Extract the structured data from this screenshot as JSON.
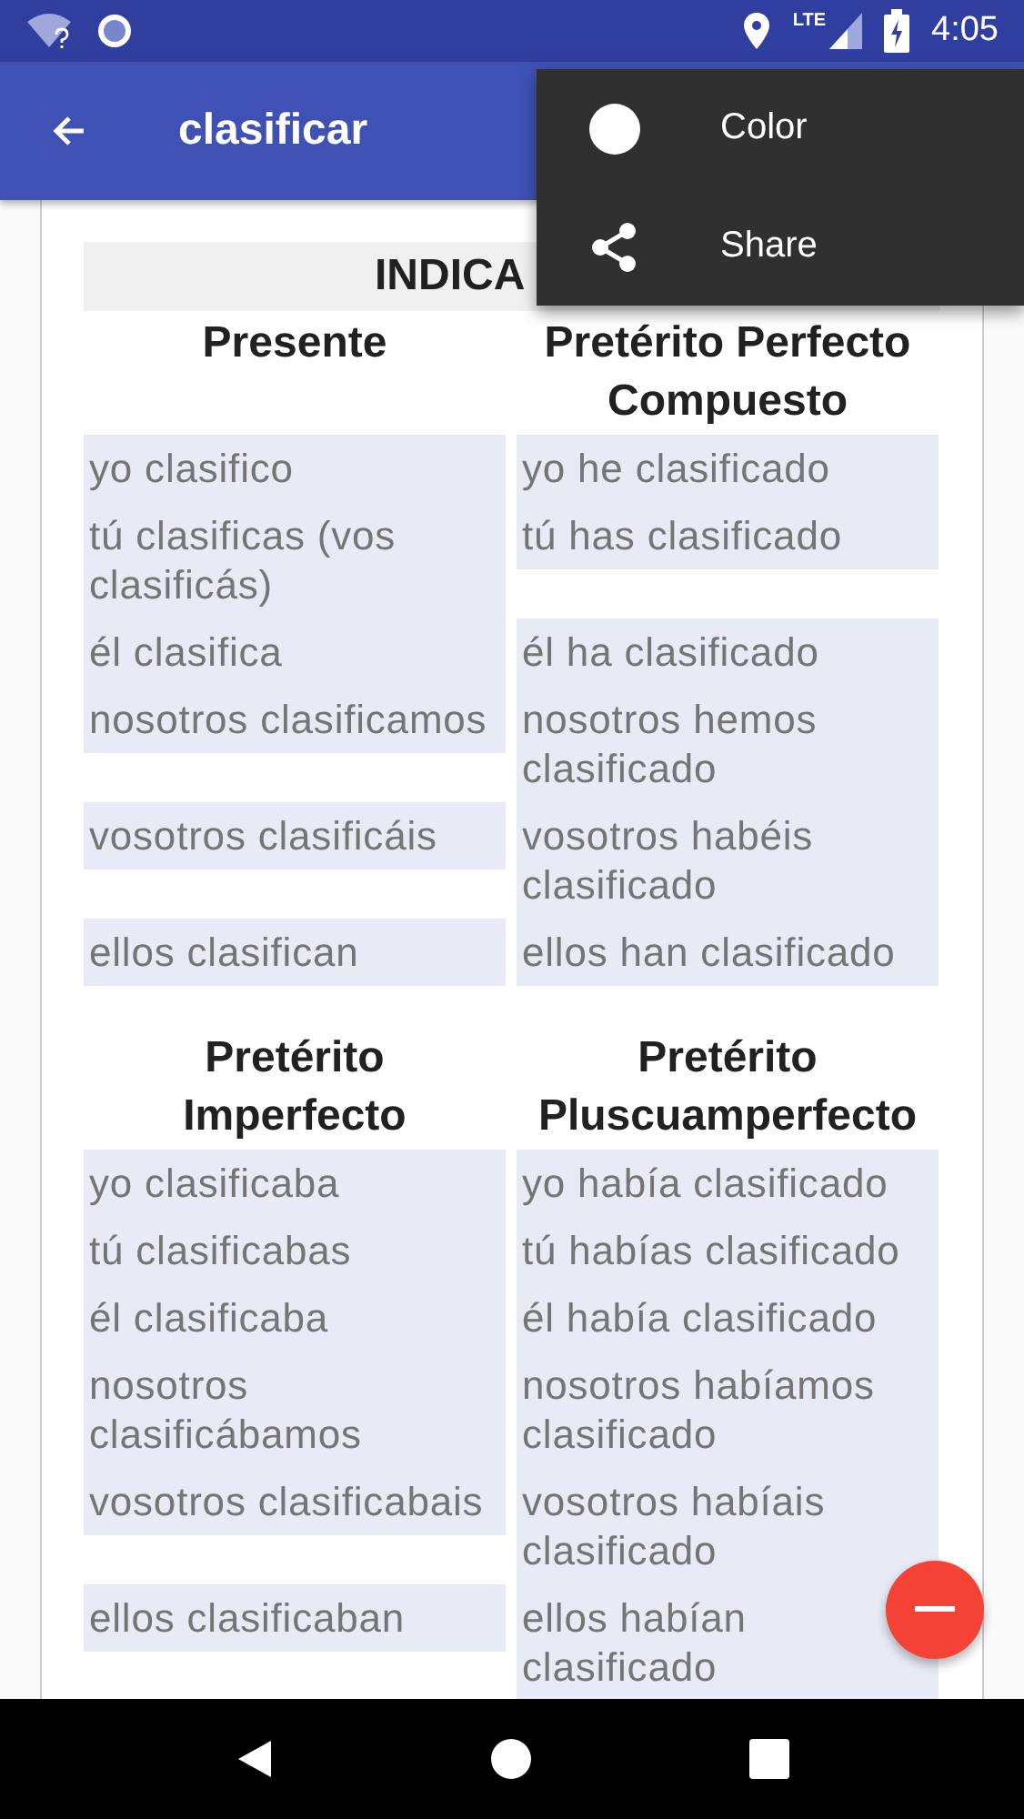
{
  "status_bar": {
    "network": "LTE",
    "time": "4:05"
  },
  "app_bar": {
    "title": "clasificar"
  },
  "menu": [
    {
      "kind": "color",
      "label": "Color"
    },
    {
      "kind": "share",
      "label": "Share"
    }
  ],
  "section_title": "INDICA",
  "groups": [
    {
      "tenses": [
        {
          "title": "Presente",
          "forms": [
            "yo clasifico",
            "tú clasificas (vos clasificás)",
            "él clasifica",
            "nosotros clasificamos",
            "vosotros clasificáis",
            "ellos clasifican"
          ]
        },
        {
          "title": "Pretérito Perfecto Compuesto",
          "forms": [
            "yo he clasificado",
            "tú has clasificado",
            "él ha clasificado",
            "nosotros hemos clasificado",
            "vosotros habéis clasificado",
            "ellos han clasificado"
          ]
        }
      ]
    },
    {
      "tenses": [
        {
          "title": "Pretérito Imperfecto",
          "forms": [
            "yo clasificaba",
            "tú clasificabas",
            "él clasificaba",
            "nosotros clasificábamos",
            "vosotros clasificabais",
            "ellos clasificaban"
          ]
        },
        {
          "title": "Pretérito Pluscuamperfecto",
          "forms": [
            "yo había clasificado",
            "tú habías clasificado",
            "él había clasificado",
            "nosotros habíamos clasificado",
            "vosotros habíais clasificado",
            "ellos habían clasificado"
          ]
        }
      ]
    }
  ]
}
